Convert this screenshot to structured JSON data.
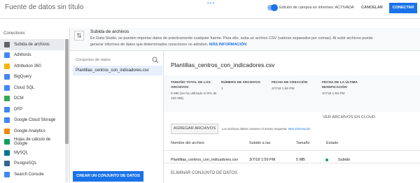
{
  "header": {
    "title": "Fuente de datos sin título",
    "dots": "•••",
    "field_edit_label": "Edición de campos en informes: ACTIVADA",
    "cancel_label": "CANCELAR",
    "connect_label": "CONECTAR"
  },
  "connectors": {
    "heading": "Conectores",
    "items": [
      {
        "label": "Subida de archivos",
        "icon": "upload-icon",
        "color": "#5f6368"
      },
      {
        "label": "AdWords",
        "icon": "adwords-icon",
        "color": "#4285f4"
      },
      {
        "label": "Attribution 360",
        "icon": "attribution-icon",
        "color": "#f4b400"
      },
      {
        "label": "BigQuery",
        "icon": "bigquery-icon",
        "color": "#4285f4"
      },
      {
        "label": "Cloud SQL",
        "icon": "cloudsql-icon",
        "color": "#4285f4"
      },
      {
        "label": "DCM",
        "icon": "dcm-icon",
        "color": "#34a853"
      },
      {
        "label": "DFP",
        "icon": "dfp-icon",
        "color": "#4285f4"
      },
      {
        "label": "Google Cloud Storage",
        "icon": "gcs-icon",
        "color": "#4285f4"
      },
      {
        "label": "Google Analytics",
        "icon": "analytics-icon",
        "color": "#f4870a"
      },
      {
        "label": "Hojas de cálculo de Google",
        "icon": "sheets-icon",
        "color": "#0f9d58"
      },
      {
        "label": "MySQL",
        "icon": "mysql-icon",
        "color": "#00758f"
      },
      {
        "label": "PostgreSQL",
        "icon": "postgresql-icon",
        "color": "#336791"
      },
      {
        "label": "Search Console",
        "icon": "search-console-icon",
        "color": "#4285f4"
      }
    ]
  },
  "banner": {
    "title": "Subida de archivos",
    "description": "En Data Studio, se pueden importar datos de prácticamente cualquier fuente. Para ello, suba un archivo CSV (valores separados por comas). Al subir archivos puede generar informes de datos que determinados conectores no admiten.",
    "link": "MÁS INFORMACIÓN"
  },
  "datasets": {
    "heading": "Conjuntos de datos",
    "items": [
      "Plantillas_centros_con_indicadores.csv"
    ],
    "create_label": "CREAR UN CONJUNTO DE DATOS"
  },
  "file": {
    "title": "Plantillas_centros_con_indicadores.csv",
    "meta": [
      {
        "label": "TAMAÑO TOTAL DE LOS ARCHIVOS",
        "value": "5 MB (Se ha utilizado el 6% de 100 MB)"
      },
      {
        "label": "NÚMERO DE ARCHIVOS",
        "value": "1"
      },
      {
        "label": "FECHA DE CREACIÓN",
        "value": "3/7/18 1:59 PM"
      },
      {
        "label": "FECHA DE LA ÚLTIMA MODIFICACIÓN",
        "value": "3/7/18 1:59 PM"
      }
    ],
    "cloud_link": "VER ARCHIVOS EN CLOUD",
    "add_files_label": "AGREGAR ARCHIVOS",
    "add_note": "Los archivos deben contener el mismo esquema.",
    "add_note_link": "Más información",
    "table": {
      "columns": [
        "Nombre del archivo",
        "Subido a las",
        "Tamaño",
        "Estado"
      ],
      "rows": [
        {
          "name": "Plantillas_centros_con_indicadores.csv",
          "uploaded": "3/7/18 1:59 PM",
          "size": "5 MB",
          "status": "Subido",
          "status_color": "#0f9d58"
        }
      ]
    },
    "delete_label": "ELIMINAR CONJUNTO DE DATOS"
  }
}
